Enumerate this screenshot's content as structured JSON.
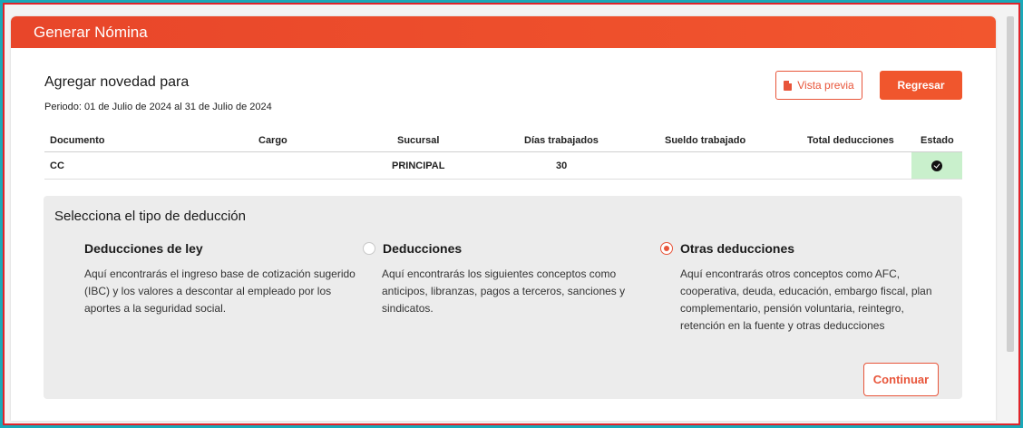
{
  "header": {
    "title": "Generar Nómina"
  },
  "novedad": {
    "title": "Agregar novedad para",
    "period": "Periodo: 01 de Julio de 2024 al 31 de Julio de 2024"
  },
  "actions": {
    "preview_label": "Vista previa",
    "back_label": "Regresar"
  },
  "table": {
    "columns": [
      "Documento",
      "Cargo",
      "Sucursal",
      "Días trabajados",
      "Sueldo trabajado",
      "Total deducciones",
      "Estado"
    ],
    "rows": [
      {
        "documento": "CC",
        "cargo": "",
        "sucursal": "PRINCIPAL",
        "dias": "30",
        "sueldo": "",
        "total": "",
        "estado": "check-circle-icon"
      }
    ]
  },
  "deduction": {
    "title": "Selecciona el tipo de deducción",
    "options": [
      {
        "label": "Deducciones de ley",
        "desc": "Aquí encontrarás el ingreso base de cotización sugerido (IBC) y los valores a descontar al empleado por los aportes a la seguridad social.",
        "selected": false
      },
      {
        "label": "Deducciones",
        "desc": "Aquí encontrarás los siguientes conceptos como anticipos, libranzas, pagos a terceros, sanciones y sindicatos.",
        "selected": false
      },
      {
        "label": "Otras deducciones",
        "desc": "Aquí encontrarás otros conceptos como AFC, cooperativa, deuda, educación, embargo fiscal, plan complementario, pensión voluntaria, reintegro, retención en la fuente y otras deducciones",
        "selected": true
      }
    ],
    "continue_label": "Continuar"
  },
  "colors": {
    "accent": "#f0562d",
    "frame": "#19a9b9",
    "success_bg": "#c9f0cc"
  }
}
